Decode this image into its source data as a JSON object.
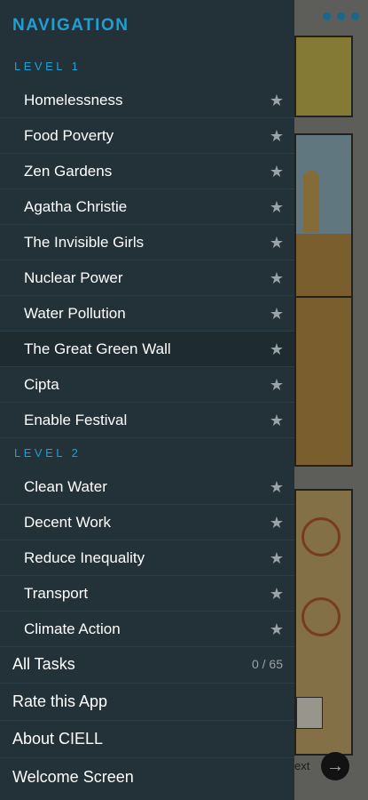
{
  "header": {
    "title": "NAVIGATION"
  },
  "levels": [
    {
      "label": "LEVEL 1",
      "items": [
        {
          "label": "Homelessness"
        },
        {
          "label": "Food Poverty"
        },
        {
          "label": "Zen Gardens"
        },
        {
          "label": "Agatha Christie"
        },
        {
          "label": "The Invisible Girls"
        },
        {
          "label": "Nuclear Power"
        },
        {
          "label": "Water Pollution"
        },
        {
          "label": "The Great Green Wall",
          "active": true
        },
        {
          "label": "Cipta"
        },
        {
          "label": "Enable Festival"
        }
      ]
    },
    {
      "label": "LEVEL 2",
      "items": [
        {
          "label": "Clean Water"
        },
        {
          "label": "Decent Work"
        },
        {
          "label": "Reduce Inequality"
        },
        {
          "label": "Transport"
        },
        {
          "label": "Climate Action"
        }
      ]
    }
  ],
  "menu": {
    "all_tasks": {
      "label": "All Tasks",
      "count": "0 / 65"
    },
    "rate": "Rate this App",
    "about": "About CIELL",
    "welcome": "Welcome Screen"
  },
  "background": {
    "next_label": "ext"
  },
  "icons": {
    "star": "star-icon",
    "more": "more-dots-icon",
    "next": "arrow-right-icon"
  },
  "colors": {
    "accent": "#1f9fd4",
    "drawer_bg": "#233138"
  }
}
